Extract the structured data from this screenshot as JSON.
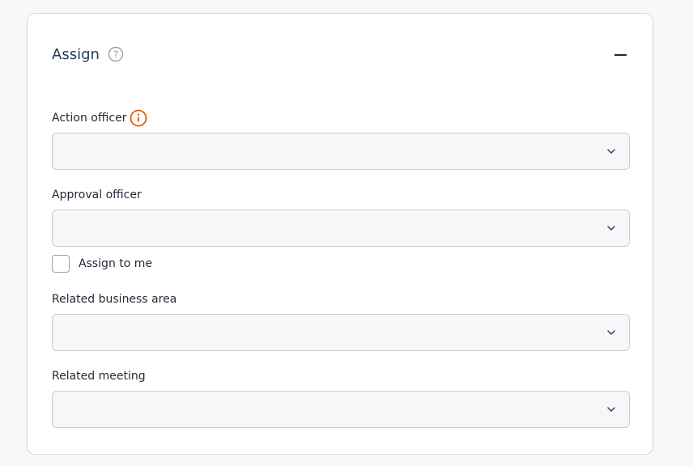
{
  "section": {
    "title": "Assign",
    "help_icon": "question-circle-icon",
    "collapse_icon": "minus-icon"
  },
  "fields": {
    "action_officer": {
      "label": "Action officer",
      "info_icon": "info-circle-icon",
      "info_color": "#e8590c",
      "value": ""
    },
    "approval_officer": {
      "label": "Approval officer",
      "value": ""
    },
    "assign_to_me": {
      "label": "Assign to me",
      "checked": false
    },
    "related_business_area": {
      "label": "Related business area",
      "value": ""
    },
    "related_meeting": {
      "label": "Related meeting",
      "value": ""
    }
  },
  "colors": {
    "title": "#1e3a5f",
    "select_bg": "#f6f7f9",
    "select_border": "#c9ccd1",
    "warning": "#e8590c"
  }
}
